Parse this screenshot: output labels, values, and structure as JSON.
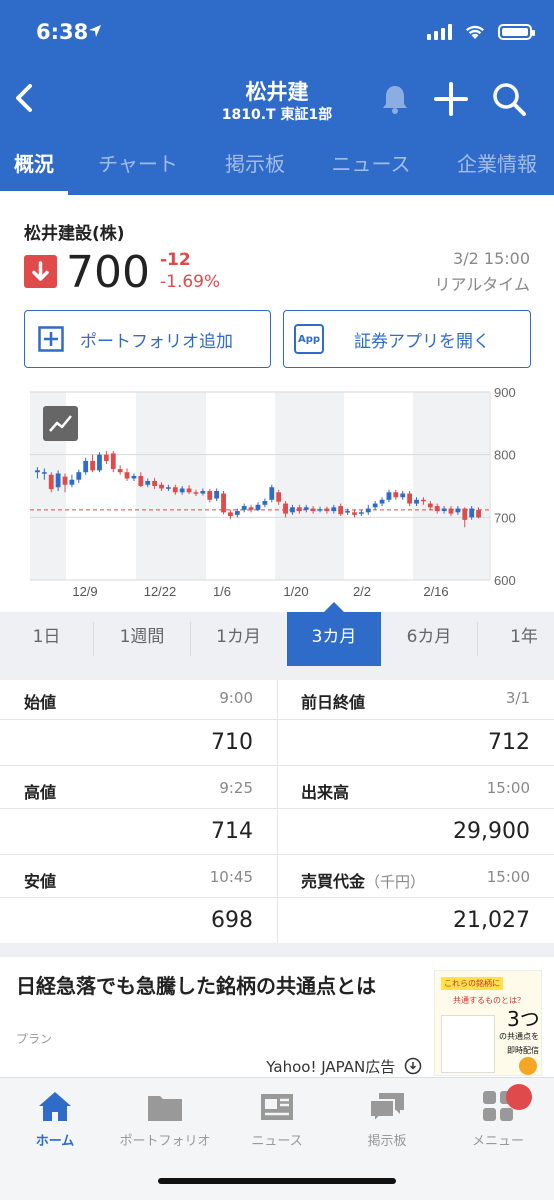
{
  "status": {
    "time": "6:38"
  },
  "header": {
    "title": "松井建",
    "subtitle": "1810.T 東証1部"
  },
  "tabs": [
    "概況",
    "チャート",
    "掲示板",
    "ニュース",
    "企業情報"
  ],
  "stock": {
    "name": "松井建設(株)",
    "price": "700",
    "change": "-12",
    "change_pct": "-1.69%",
    "datetime": "3/2 15:00",
    "realtime": "リアルタイム"
  },
  "actions": {
    "portfolio": "ポートフォリオ追加",
    "app": "証券アプリを開く",
    "app_icon_text": "App"
  },
  "chart_data": {
    "type": "candlestick",
    "y_ticks": [
      "900",
      "800",
      "700",
      "600"
    ],
    "ylim": [
      600,
      900
    ],
    "x_ticks": [
      "12/9",
      "12/22",
      "1/6",
      "1/20",
      "2/2",
      "2/16"
    ],
    "reference_line": 712,
    "candles": [
      {
        "o": 772,
        "c": 775,
        "h": 780,
        "l": 762
      },
      {
        "o": 770,
        "c": 772,
        "h": 778,
        "l": 760
      },
      {
        "o": 768,
        "c": 745,
        "h": 772,
        "l": 740
      },
      {
        "o": 748,
        "c": 770,
        "h": 775,
        "l": 742
      },
      {
        "o": 765,
        "c": 752,
        "h": 770,
        "l": 740
      },
      {
        "o": 752,
        "c": 760,
        "h": 768,
        "l": 748
      },
      {
        "o": 760,
        "c": 772,
        "h": 776,
        "l": 755
      },
      {
        "o": 772,
        "c": 790,
        "h": 795,
        "l": 768
      },
      {
        "o": 790,
        "c": 775,
        "h": 800,
        "l": 772
      },
      {
        "o": 775,
        "c": 800,
        "h": 804,
        "l": 772
      },
      {
        "o": 800,
        "c": 790,
        "h": 806,
        "l": 785
      },
      {
        "o": 802,
        "c": 777,
        "h": 806,
        "l": 772
      },
      {
        "o": 777,
        "c": 772,
        "h": 783,
        "l": 768
      },
      {
        "o": 772,
        "c": 762,
        "h": 778,
        "l": 758
      },
      {
        "o": 762,
        "c": 766,
        "h": 770,
        "l": 758
      },
      {
        "o": 766,
        "c": 750,
        "h": 772,
        "l": 748
      },
      {
        "o": 752,
        "c": 758,
        "h": 762,
        "l": 748
      },
      {
        "o": 758,
        "c": 750,
        "h": 763,
        "l": 745
      },
      {
        "o": 752,
        "c": 746,
        "h": 756,
        "l": 742
      },
      {
        "o": 746,
        "c": 748,
        "h": 752,
        "l": 742
      },
      {
        "o": 748,
        "c": 740,
        "h": 752,
        "l": 736
      },
      {
        "o": 740,
        "c": 746,
        "h": 750,
        "l": 736
      },
      {
        "o": 746,
        "c": 740,
        "h": 751,
        "l": 737
      },
      {
        "o": 740,
        "c": 738,
        "h": 744,
        "l": 734
      },
      {
        "o": 738,
        "c": 742,
        "h": 746,
        "l": 735
      },
      {
        "o": 742,
        "c": 728,
        "h": 745,
        "l": 724
      },
      {
        "o": 730,
        "c": 742,
        "h": 746,
        "l": 726
      },
      {
        "o": 738,
        "c": 708,
        "h": 742,
        "l": 705
      },
      {
        "o": 708,
        "c": 702,
        "h": 712,
        "l": 697
      },
      {
        "o": 704,
        "c": 710,
        "h": 714,
        "l": 700
      },
      {
        "o": 712,
        "c": 718,
        "h": 722,
        "l": 708
      },
      {
        "o": 716,
        "c": 712,
        "h": 720,
        "l": 708
      },
      {
        "o": 712,
        "c": 720,
        "h": 724,
        "l": 710
      },
      {
        "o": 720,
        "c": 726,
        "h": 730,
        "l": 716
      },
      {
        "o": 728,
        "c": 748,
        "h": 752,
        "l": 724
      },
      {
        "o": 740,
        "c": 725,
        "h": 744,
        "l": 720
      },
      {
        "o": 722,
        "c": 706,
        "h": 726,
        "l": 700
      },
      {
        "o": 708,
        "c": 716,
        "h": 720,
        "l": 704
      },
      {
        "o": 716,
        "c": 710,
        "h": 720,
        "l": 706
      },
      {
        "o": 712,
        "c": 716,
        "h": 720,
        "l": 708
      },
      {
        "o": 714,
        "c": 710,
        "h": 718,
        "l": 706
      },
      {
        "o": 711,
        "c": 713,
        "h": 717,
        "l": 708
      },
      {
        "o": 714,
        "c": 710,
        "h": 717,
        "l": 706
      },
      {
        "o": 710,
        "c": 716,
        "h": 720,
        "l": 706
      },
      {
        "o": 718,
        "c": 705,
        "h": 722,
        "l": 702
      },
      {
        "o": 708,
        "c": 710,
        "h": 714,
        "l": 704
      },
      {
        "o": 708,
        "c": 704,
        "h": 712,
        "l": 700
      },
      {
        "o": 706,
        "c": 708,
        "h": 712,
        "l": 702
      },
      {
        "o": 708,
        "c": 714,
        "h": 720,
        "l": 704
      },
      {
        "o": 716,
        "c": 722,
        "h": 726,
        "l": 712
      },
      {
        "o": 722,
        "c": 728,
        "h": 732,
        "l": 718
      },
      {
        "o": 728,
        "c": 740,
        "h": 744,
        "l": 724
      },
      {
        "o": 740,
        "c": 732,
        "h": 744,
        "l": 728
      },
      {
        "o": 732,
        "c": 738,
        "h": 742,
        "l": 728
      },
      {
        "o": 738,
        "c": 722,
        "h": 742,
        "l": 718
      },
      {
        "o": 722,
        "c": 728,
        "h": 732,
        "l": 718
      },
      {
        "o": 728,
        "c": 726,
        "h": 732,
        "l": 720
      },
      {
        "o": 722,
        "c": 716,
        "h": 726,
        "l": 712
      },
      {
        "o": 718,
        "c": 710,
        "h": 722,
        "l": 706
      },
      {
        "o": 710,
        "c": 714,
        "h": 718,
        "l": 706
      },
      {
        "o": 714,
        "c": 706,
        "h": 718,
        "l": 702
      },
      {
        "o": 708,
        "c": 714,
        "h": 718,
        "l": 704
      },
      {
        "o": 714,
        "c": 696,
        "h": 716,
        "l": 684
      },
      {
        "o": 700,
        "c": 714,
        "h": 718,
        "l": 696
      },
      {
        "o": 712,
        "c": 700,
        "h": 716,
        "l": 698
      }
    ]
  },
  "periods": [
    "1日",
    "1週間",
    "1カ月",
    "3カ月",
    "6カ月",
    "1年"
  ],
  "stats": {
    "open": {
      "label": "始値",
      "time": "9:00",
      "value": "710"
    },
    "prev_close": {
      "label": "前日終値",
      "time": "3/1",
      "value": "712"
    },
    "high": {
      "label": "高値",
      "time": "9:25",
      "value": "714"
    },
    "volume": {
      "label": "出来高",
      "time": "15:00",
      "value": "29,900"
    },
    "low": {
      "label": "安値",
      "time": "10:45",
      "value": "698"
    },
    "turnover": {
      "label": "売買代金",
      "unit": "（千円）",
      "time": "15:00",
      "value": "21,027"
    }
  },
  "ad": {
    "title": "日経急落でも急騰した銘柄の共通点とは",
    "sponsor": "プラン",
    "credit": "Yahoo! JAPAN広告",
    "thumb_lines": [
      "これらの銘柄に",
      "共通するものとは？",
      "3つ",
      "の共通点を",
      "即時配信"
    ]
  },
  "bottom_nav": [
    "ホーム",
    "ポートフォリオ",
    "ニュース",
    "掲示板",
    "メニュー"
  ],
  "colors": {
    "brand": "#2f6bc9",
    "down": "#e04a4a",
    "up": "#2f6bc9"
  }
}
